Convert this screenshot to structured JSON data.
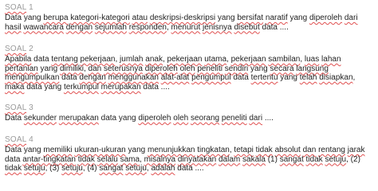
{
  "soal": [
    {
      "title_word": "SOAL",
      "title_number": "1",
      "segments": [
        {
          "t": "Data yang ",
          "u": false
        },
        {
          "t": "berupa",
          "u": true
        },
        {
          "t": " ",
          "u": false
        },
        {
          "t": "kategori-kategori",
          "u": true
        },
        {
          "t": " ",
          "u": false
        },
        {
          "t": "atau",
          "u": true
        },
        {
          "t": " ",
          "u": false
        },
        {
          "t": "deskripsi-deskripsi",
          "u": true
        },
        {
          "t": " yang ",
          "u": false
        },
        {
          "t": "bersifat",
          "u": true
        },
        {
          "t": " ",
          "u": false
        },
        {
          "t": "naratif",
          "u": true
        },
        {
          "t": " yang ",
          "u": false
        },
        {
          "t": "diperoleh",
          "u": true
        },
        {
          "t": " ",
          "u": false
        },
        {
          "t": "dari",
          "u": true
        },
        {
          "t": " ",
          "u": false
        },
        {
          "t": "hasil",
          "u": true
        },
        {
          "t": " ",
          "u": false
        },
        {
          "t": "wawancara",
          "u": true
        },
        {
          "t": " ",
          "u": false
        },
        {
          "t": "dengan",
          "u": true
        },
        {
          "t": " ",
          "u": false
        },
        {
          "t": "sejumlah",
          "u": true
        },
        {
          "t": " ",
          "u": false
        },
        {
          "t": "responden",
          "u": true
        },
        {
          "t": ", ",
          "u": false
        },
        {
          "t": "menurut",
          "u": true
        },
        {
          "t": " ",
          "u": false
        },
        {
          "t": "jenisnya",
          "u": true
        },
        {
          "t": " ",
          "u": false
        },
        {
          "t": "disebut",
          "u": true
        },
        {
          "t": " data ....",
          "u": false
        }
      ]
    },
    {
      "title_word": "SOAL",
      "title_number": "2",
      "segments": [
        {
          "t": "Apabila",
          "u": true
        },
        {
          "t": " data ",
          "u": false
        },
        {
          "t": "tentang",
          "u": true
        },
        {
          "t": " ",
          "u": false
        },
        {
          "t": "pekerjaan",
          "u": true
        },
        {
          "t": ", ",
          "u": false
        },
        {
          "t": "jumlah",
          "u": true
        },
        {
          "t": " ",
          "u": false
        },
        {
          "t": "anak",
          "u": true
        },
        {
          "t": ", ",
          "u": false
        },
        {
          "t": "pekerjaan",
          "u": true
        },
        {
          "t": " ",
          "u": false
        },
        {
          "t": "utama",
          "u": true
        },
        {
          "t": ", ",
          "u": false
        },
        {
          "t": "pekerjaan",
          "u": true
        },
        {
          "t": " ",
          "u": false
        },
        {
          "t": "sambilan",
          "u": true
        },
        {
          "t": ", ",
          "u": false
        },
        {
          "t": "luas",
          "u": true
        },
        {
          "t": " ",
          "u": false
        },
        {
          "t": "lahan",
          "u": true
        },
        {
          "t": " ",
          "u": false
        },
        {
          "t": "pertanian",
          "u": true
        },
        {
          "t": " yang ",
          "u": false
        },
        {
          "t": "dimiliki",
          "u": true
        },
        {
          "t": ", ",
          "u": false
        },
        {
          "t": "dan",
          "u": true
        },
        {
          "t": " ",
          "u": false
        },
        {
          "t": "seterusnya",
          "u": true
        },
        {
          "t": " ",
          "u": false
        },
        {
          "t": "diperoleh",
          "u": true
        },
        {
          "t": " ",
          "u": false
        },
        {
          "t": "oleh",
          "u": true
        },
        {
          "t": " ",
          "u": false
        },
        {
          "t": "peneliti",
          "u": true
        },
        {
          "t": " ",
          "u": false
        },
        {
          "t": "sendiri",
          "u": true
        },
        {
          "t": " yang ",
          "u": false
        },
        {
          "t": "secara",
          "u": true
        },
        {
          "t": " ",
          "u": false
        },
        {
          "t": "langsung",
          "u": true
        },
        {
          "t": " ",
          "u": false
        },
        {
          "t": "mengumpulkan",
          "u": true
        },
        {
          "t": " data ",
          "u": false
        },
        {
          "t": "dengan",
          "u": true
        },
        {
          "t": " ",
          "u": false
        },
        {
          "t": "menggunakan",
          "u": true
        },
        {
          "t": " ",
          "u": false
        },
        {
          "t": "alat-alat",
          "u": true
        },
        {
          "t": " ",
          "u": false
        },
        {
          "t": "pengumpul",
          "u": true
        },
        {
          "t": " data ",
          "u": false
        },
        {
          "t": "tertentu",
          "u": true
        },
        {
          "t": " yang ",
          "u": false
        },
        {
          "t": "telah",
          "u": true
        },
        {
          "t": " ",
          "u": false
        },
        {
          "t": "disiapkan",
          "u": true
        },
        {
          "t": ", ",
          "u": false
        },
        {
          "t": "maka",
          "u": true
        },
        {
          "t": " data yang ",
          "u": false
        },
        {
          "t": "terkumpul",
          "u": true
        },
        {
          "t": " ",
          "u": false
        },
        {
          "t": "merupakan",
          "u": true
        },
        {
          "t": " data ....",
          "u": false
        }
      ]
    },
    {
      "title_word": "SOAL",
      "title_number": "3",
      "segments": [
        {
          "t": "Data ",
          "u": false
        },
        {
          "t": "sekunder",
          "u": true
        },
        {
          "t": " ",
          "u": false
        },
        {
          "t": "merupakan",
          "u": true
        },
        {
          "t": " data yang ",
          "u": false
        },
        {
          "t": "diperoleh",
          "u": true
        },
        {
          "t": " ",
          "u": false
        },
        {
          "t": "oleh",
          "u": true
        },
        {
          "t": " ",
          "u": false
        },
        {
          "t": "seorang",
          "u": true
        },
        {
          "t": " ",
          "u": false
        },
        {
          "t": "peneliti",
          "u": true
        },
        {
          "t": " ",
          "u": false
        },
        {
          "t": "dari",
          "u": true
        },
        {
          "t": " ....",
          "u": false
        }
      ]
    },
    {
      "title_word": "SOAL",
      "title_number": "4",
      "segments": [
        {
          "t": "Data yang ",
          "u": false
        },
        {
          "t": "memiliki",
          "u": true
        },
        {
          "t": " ",
          "u": false
        },
        {
          "t": "ukuran-ukuran",
          "u": true
        },
        {
          "t": " yang ",
          "u": false
        },
        {
          "t": "menunjukkan",
          "u": true
        },
        {
          "t": " ",
          "u": false
        },
        {
          "t": "tingkatan",
          "u": true
        },
        {
          "t": ", ",
          "u": false
        },
        {
          "t": "tetapi",
          "u": true
        },
        {
          "t": " ",
          "u": false
        },
        {
          "t": "tidak",
          "u": true
        },
        {
          "t": " ",
          "u": false
        },
        {
          "t": "absolut",
          "u": true
        },
        {
          "t": " ",
          "u": false
        },
        {
          "t": "dan",
          "u": true
        },
        {
          "t": " ",
          "u": false
        },
        {
          "t": "rentang",
          "u": true
        },
        {
          "t": " ",
          "u": false
        },
        {
          "t": "jarak",
          "u": true
        },
        {
          "t": " data ",
          "u": false
        },
        {
          "t": "antar-tingkatan",
          "u": true
        },
        {
          "t": " ",
          "u": false
        },
        {
          "t": "tidak",
          "u": true
        },
        {
          "t": " ",
          "u": false
        },
        {
          "t": "selalu",
          "u": true
        },
        {
          "t": " ",
          "u": false
        },
        {
          "t": "sama",
          "u": true
        },
        {
          "t": ", ",
          "u": false
        },
        {
          "t": "misalnya",
          "u": true
        },
        {
          "t": " ",
          "u": false
        },
        {
          "t": "dinyatakan",
          "u": true
        },
        {
          "t": " ",
          "u": false
        },
        {
          "t": "dalam",
          "u": true
        },
        {
          "t": " ",
          "u": false
        },
        {
          "t": "sakala",
          "u": true
        },
        {
          "t": " (1) ",
          "u": false
        },
        {
          "t": "sangat",
          "u": true
        },
        {
          "t": " ",
          "u": false
        },
        {
          "t": "tidak",
          "u": true
        },
        {
          "t": " ",
          "u": false
        },
        {
          "t": "setuju",
          "u": true
        },
        {
          "t": ", (2) ",
          "u": false
        },
        {
          "t": "tidak",
          "u": true
        },
        {
          "t": " ",
          "u": false
        },
        {
          "t": "setuju",
          "u": true
        },
        {
          "t": ", (3) ",
          "u": false
        },
        {
          "t": "setuju",
          "u": true
        },
        {
          "t": ", (4) ",
          "u": false
        },
        {
          "t": "sangat",
          "u": true
        },
        {
          "t": " ",
          "u": false
        },
        {
          "t": "setuju",
          "u": true
        },
        {
          "t": ", ",
          "u": false
        },
        {
          "t": "adalah",
          "u": true
        },
        {
          "t": " data ....",
          "u": false
        }
      ]
    }
  ]
}
